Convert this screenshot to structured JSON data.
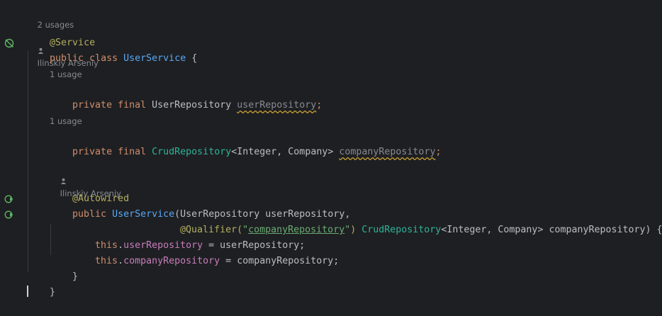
{
  "hints": {
    "class_usages": "2 usages",
    "class_author": "Ilinskiy Arseniy",
    "field1_usage": "1 usage",
    "field2_usage": "1 usage",
    "ctor_author": "Ilinskiy Arseniy"
  },
  "code": {
    "l1_annotation": "@Service",
    "l2_public": "public",
    "l2_class": "class",
    "l2_name": "UserService",
    "l2_brace": " {",
    "l3_private": "private",
    "l3_final": "final",
    "l3_type": "UserRepository",
    "l3_name": "userRepository",
    "l3_semi": ";",
    "l4_private": "private",
    "l4_final": "final",
    "l4_type": "CrudRepository",
    "l4_generic_open": "<",
    "l4_t1": "Integer",
    "l4_comma": ", ",
    "l4_t2": "Company",
    "l4_generic_close": "> ",
    "l4_name": "companyRepository",
    "l4_semi": ";",
    "l5_annotation": "@Autowired",
    "l6_public": "public",
    "l6_name": "UserService",
    "l6_paren": "(",
    "l6_type": "UserRepository",
    "l6_param": " userRepository,",
    "l7_qual": "@Qualifier(",
    "l7_q1": "\"",
    "l7_str": "companyRepository",
    "l7_q2": "\"",
    "l7_qclose": ") ",
    "l7_type": "CrudRepository",
    "l7_go": "<",
    "l7_t1": "Integer",
    "l7_comma": ", ",
    "l7_t2": "Company",
    "l7_gc": "> ",
    "l7_param": "companyRepository",
    "l7_end": ") {",
    "l8_this": "this",
    "l8_dot": ".",
    "l8_field": "userRepository",
    "l8_rest": " = userRepository;",
    "l9_this": "this",
    "l9_dot": ".",
    "l9_field": "companyRepository",
    "l9_rest": " = companyRepository;",
    "l10_brace": "}",
    "l11_brace": "}"
  },
  "colors": {
    "background": "#1e1f22",
    "keyword": "#cf8e6d",
    "annotation": "#b3ae60",
    "field": "#c77dbb",
    "string": "#6aab73",
    "hint": "#868a91"
  },
  "icons": {
    "bean_class": "spring-bean-icon",
    "autowired_1": "autowired-navigate-icon",
    "autowired_2": "autowired-navigate-icon"
  }
}
